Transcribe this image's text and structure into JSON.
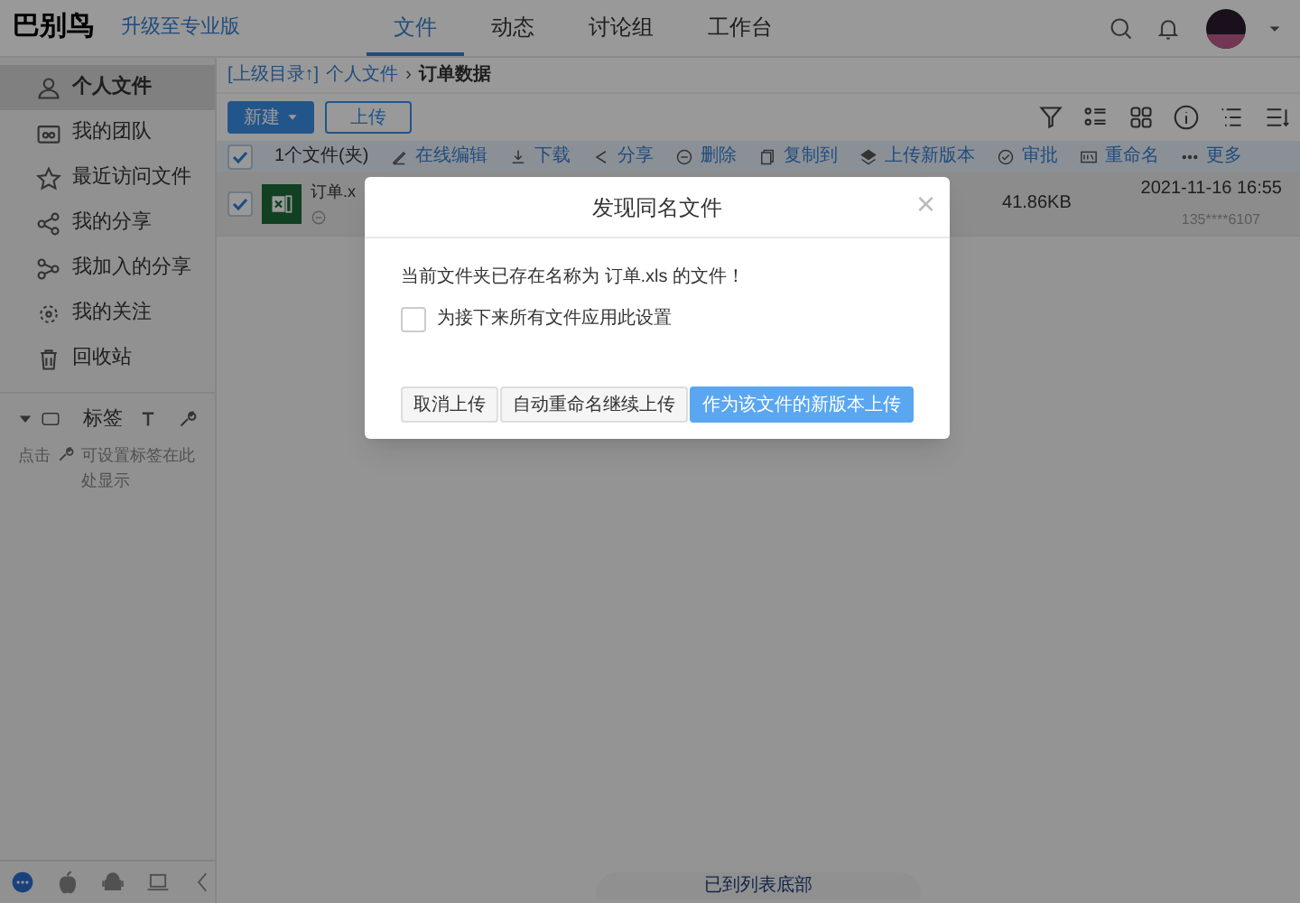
{
  "header": {
    "logo": "巴别鸟",
    "upgrade_link": "升级至专业版",
    "tabs": [
      {
        "label": "文件",
        "selected": true
      },
      {
        "label": "动态",
        "selected": false
      },
      {
        "label": "讨论组",
        "selected": false
      },
      {
        "label": "工作台",
        "selected": false
      }
    ]
  },
  "sidebar": {
    "items": [
      {
        "label": "个人文件",
        "selected": true
      },
      {
        "label": "我的团队",
        "selected": false
      },
      {
        "label": "最近访问文件",
        "selected": false
      },
      {
        "label": "我的分享",
        "selected": false
      },
      {
        "label": "我加入的分享",
        "selected": false
      },
      {
        "label": "我的关注",
        "selected": false
      },
      {
        "label": "回收站",
        "selected": false
      }
    ],
    "tags": {
      "title": "标签",
      "hint_before": "点击",
      "hint_after": "可设置标签在此处显示"
    }
  },
  "breadcrumb": {
    "up": "[上级目录↑]",
    "parent": "个人文件",
    "separator": "›",
    "current": "订单数据"
  },
  "buttons": {
    "new": "新建",
    "upload": "上传"
  },
  "toolbar": {
    "checked": true,
    "count": "1个文件(夹)",
    "actions": [
      "在线编辑",
      "下载",
      "分享",
      "删除",
      "复制到",
      "上传新版本",
      "审批",
      "重命名",
      "更多"
    ]
  },
  "files": [
    {
      "name": "订单.x",
      "checked": true,
      "size": "41.86KB",
      "modified": "2021-11-16 16:55",
      "owner": "135****6107"
    }
  ],
  "list_end": "已到列表底部",
  "dialog": {
    "title": "发现同名文件",
    "close": "×",
    "message": "当前文件夹已存在名称为 订单.xls 的文件！",
    "apply_all": {
      "label": "为接下来所有文件应用此设置",
      "checked": false
    },
    "buttons": [
      {
        "label": "取消上传",
        "kind": "default"
      },
      {
        "label": "自动重命名继续上传",
        "kind": "default"
      },
      {
        "label": "作为该文件的新版本上传",
        "kind": "primary"
      }
    ]
  }
}
